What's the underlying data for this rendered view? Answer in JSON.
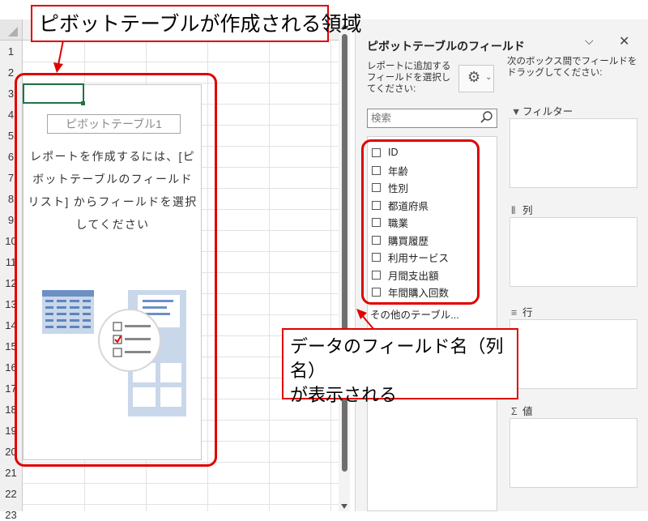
{
  "annotations": {
    "pivot_area_callout": "ピボットテーブルが作成される領域",
    "field_names_callout_line1": "データのフィールド名（列名）",
    "field_names_callout_line2": "が表示される"
  },
  "sheet": {
    "row_numbers": [
      "1",
      "2",
      "3",
      "4",
      "5",
      "6",
      "7",
      "8",
      "9",
      "10",
      "11",
      "12",
      "13",
      "14",
      "15",
      "16",
      "17",
      "18",
      "19",
      "20",
      "21",
      "22",
      "23"
    ],
    "pivot_name": "ピボットテーブル1",
    "pivot_instructions": [
      "レポートを作成するには、[ピ",
      "ボットテーブルのフィールド",
      "リスト] からフィールドを選択",
      "してください"
    ]
  },
  "pane": {
    "title": "ピボットテーブルのフィールド",
    "chevron_icon": "chevron-down-icon",
    "close_icon": "close-icon",
    "add_fields_instruction": "レポートに追加するフィールドを選択してください:",
    "gear_icon": "gear-icon",
    "search_placeholder": "検索",
    "fields": [
      "ID",
      "年齢",
      "性別",
      "都道府県",
      "職業",
      "購買履歴",
      "利用サービス",
      "月間支出額",
      "年間購入回数"
    ],
    "more_tables": "その他のテーブル...",
    "drag_instruction": "次のボックス間でフィールドをドラッグしてください:",
    "areas": {
      "filter": "フィルター",
      "columns": "列",
      "rows": "行",
      "values": "値"
    }
  },
  "colors": {
    "accent_red": "#e00000",
    "excel_green": "#217346",
    "pane_bg": "#f3f3f3"
  }
}
